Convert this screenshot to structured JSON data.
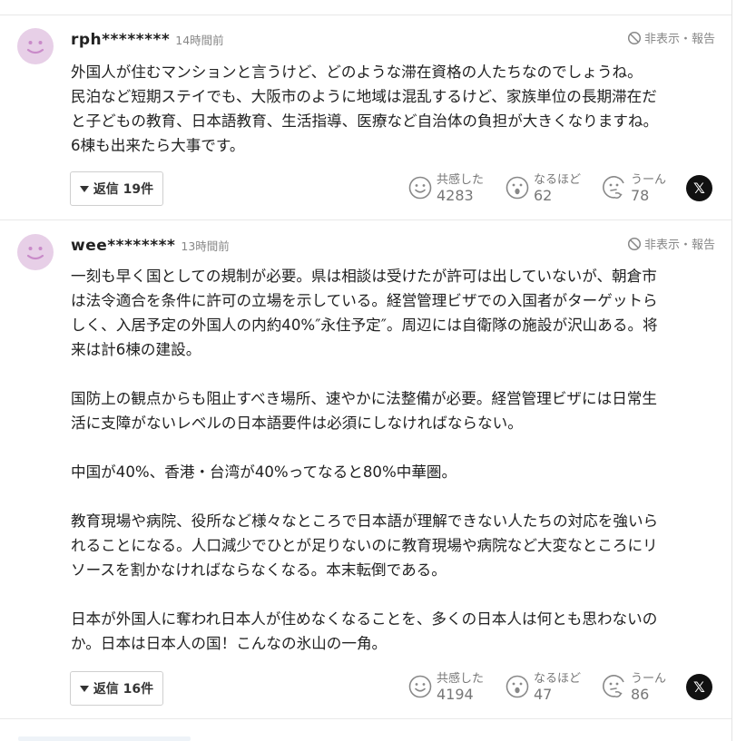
{
  "comments": [
    {
      "user": "rph********",
      "time": "14時間前",
      "hide_label": "非表示・報告",
      "lines": [
        "外国人が住むマンションと言うけど、どのような滞在資格の人たちなのでしょうね。",
        "民泊など短期ステイでも、大阪市のように地域は混乱するけど、家族単位の長期滞在だ",
        "と子どもの教育、日本語教育、生活指導、医療など自治体の負担が大きくなりますね。",
        "6棟も出来たら大事です。"
      ],
      "reply_label": "返信 19件",
      "reactions": [
        {
          "label": "共感した",
          "count": "4283",
          "icon": "smile-icon"
        },
        {
          "label": "なるほど",
          "count": "62",
          "icon": "surprised-icon"
        },
        {
          "label": "うーん",
          "count": "78",
          "icon": "thinking-icon"
        }
      ]
    },
    {
      "user": "wee********",
      "time": "13時間前",
      "hide_label": "非表示・報告",
      "paragraphs": [
        [
          "一刻も早く国としての規制が必要。県は相談は受けたが許可は出していないが、朝倉市",
          "は法令適合を条件に許可の立場を示している。経営管理ビザでの入国者がターゲットら",
          "しく、入居予定の外国人の内約40%″永住予定″。周辺には自衛隊の施設が沢山ある。将",
          "来は計6棟の建設。"
        ],
        [
          "国防上の観点からも阻止すべき場所、速やかに法整備が必要。経営管理ビザには日常生",
          "活に支障がないレベルの日本語要件は必須にしなければならない。"
        ],
        [
          "中国が40%、香港・台湾が40%ってなると80%中華圏。"
        ],
        [
          "教育現場や病院、役所など様々なところで日本語が理解できない人たちの対応を強いら",
          "れることになる。人口減少でひとが足りないのに教育現場や病院など大変なところにリ",
          "ソースを割かなければならなくなる。本末転倒である。"
        ],
        [
          "日本が外国人に奪われ日本人が住めなくなることを、多くの日本人は何とも思わないの",
          "か。日本は日本人の国！こんなの氷山の一角。"
        ]
      ],
      "reply_label": "返信 16件",
      "reactions": [
        {
          "label": "共感した",
          "count": "4194",
          "icon": "smile-icon"
        },
        {
          "label": "なるほど",
          "count": "47",
          "icon": "surprised-icon"
        },
        {
          "label": "うーん",
          "count": "86",
          "icon": "thinking-icon"
        }
      ]
    }
  ],
  "share_icon": "x-logo-icon",
  "share_glyph": "𝕏",
  "colors": {
    "avatar_bg": "#e7cfe7",
    "avatar_face": "#c98ac9",
    "muted_text": "#777777",
    "x_button": "#111111"
  }
}
